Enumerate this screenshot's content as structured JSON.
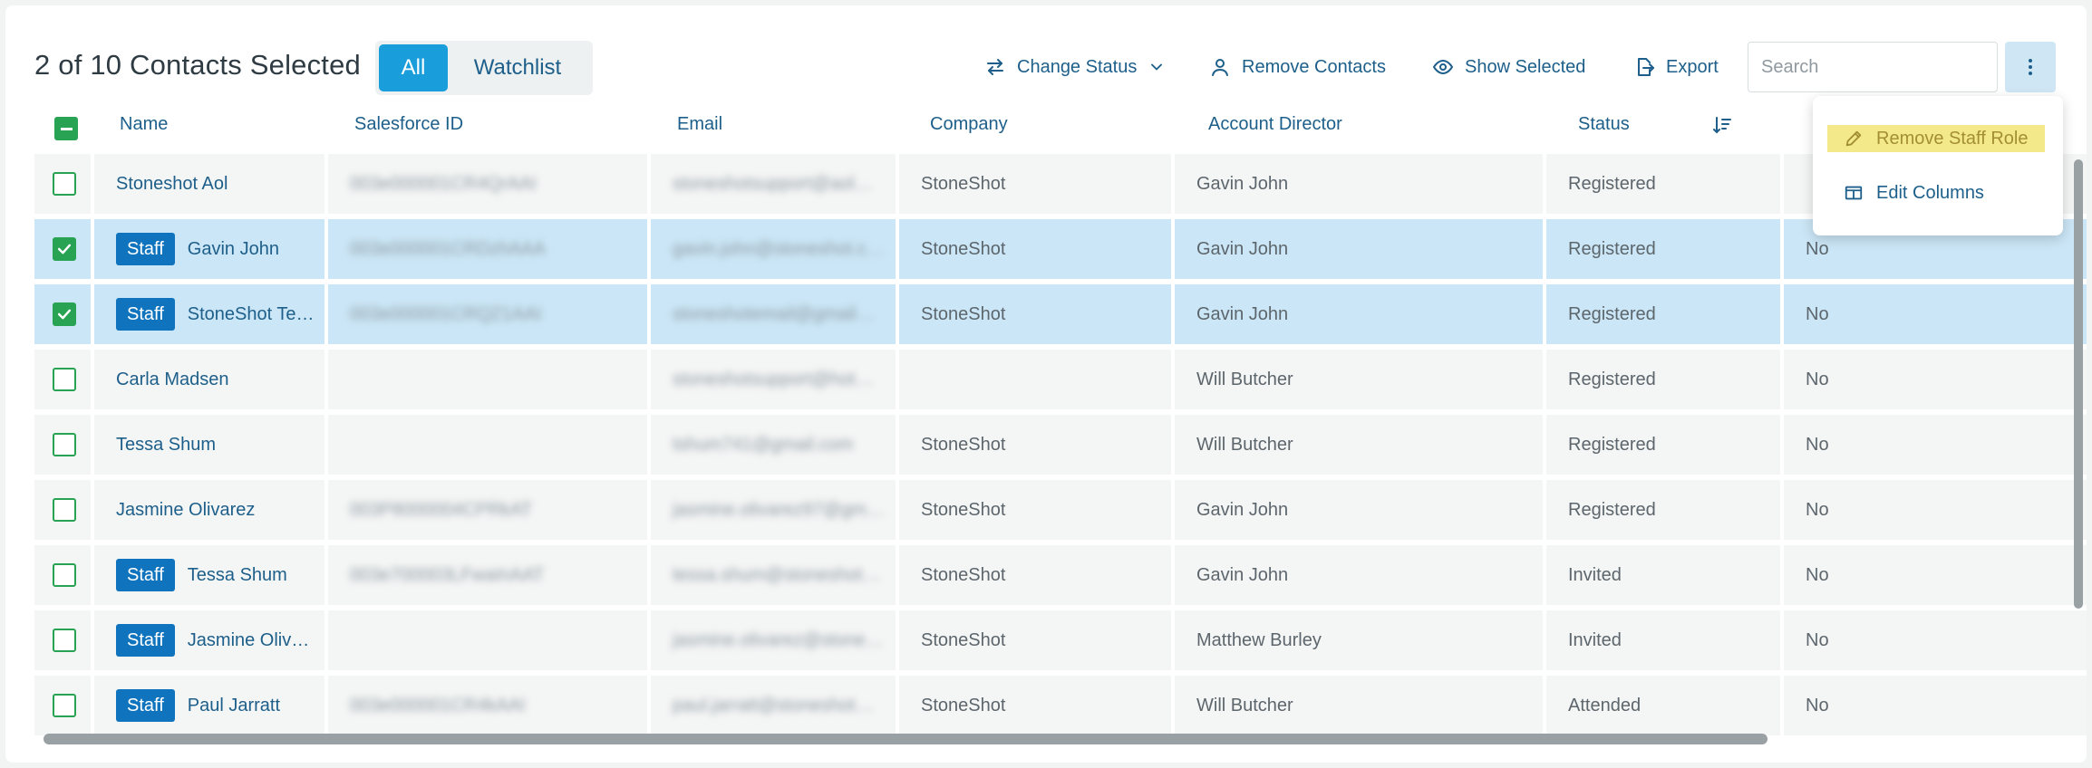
{
  "header": {
    "selected_count": "2 of 10 Contacts Selected",
    "filter_tabs": [
      {
        "label": "All",
        "active": true
      },
      {
        "label": "Watchlist",
        "active": false
      }
    ]
  },
  "toolbar": {
    "change_status": "Change Status",
    "remove_contacts": "Remove Contacts",
    "show_selected": "Show Selected",
    "export": "Export",
    "search_placeholder": "Search"
  },
  "table": {
    "columns": [
      "Name",
      "Salesforce ID",
      "Email",
      "Company",
      "Account Director",
      "Status"
    ],
    "staff_label": "Staff",
    "rows": [
      {
        "checked": false,
        "staff": false,
        "name": "Stoneshot Aol",
        "salesforce_id": "003e000001CR4QrAAI",
        "email": "stoneshotsupport@aol…",
        "company": "StoneShot",
        "director": "Gavin John",
        "status": "Registered",
        "extra": ""
      },
      {
        "checked": true,
        "staff": true,
        "name": "Gavin John",
        "salesforce_id": "003e000001CRDzhAAA",
        "email": "gavin.john@stoneshot.c…",
        "company": "StoneShot",
        "director": "Gavin John",
        "status": "Registered",
        "extra": "No"
      },
      {
        "checked": true,
        "staff": true,
        "name": "StoneShot Te…",
        "salesforce_id": "003e000001CRQZ1AAI",
        "email": "stoneshotemail@gmail…",
        "company": "StoneShot",
        "director": "Gavin John",
        "status": "Registered",
        "extra": "No"
      },
      {
        "checked": false,
        "staff": false,
        "name": "Carla Madsen",
        "salesforce_id": "",
        "email": "stoneshotsupport@hot…",
        "company": "",
        "director": "Will Butcher",
        "status": "Registered",
        "extra": "No"
      },
      {
        "checked": false,
        "staff": false,
        "name": "Tessa Shum",
        "salesforce_id": "",
        "email": "tshum741@gmail.com",
        "company": "StoneShot",
        "director": "Will Butcher",
        "status": "Registered",
        "extra": "No"
      },
      {
        "checked": false,
        "staff": false,
        "name": "Jasmine Olivarez",
        "salesforce_id": "003P8000004CPRkAT",
        "email": "jasmine.olivarez97@gm…",
        "company": "StoneShot",
        "director": "Gavin John",
        "status": "Registered",
        "extra": "No"
      },
      {
        "checked": false,
        "staff": true,
        "name": "Tessa Shum",
        "salesforce_id": "003e700003LFwaInAAT",
        "email": "tessa.shum@stoneshot…",
        "company": "StoneShot",
        "director": "Gavin John",
        "status": "Invited",
        "extra": "No"
      },
      {
        "checked": false,
        "staff": true,
        "name": "Jasmine Oliv…",
        "salesforce_id": "",
        "email": "jasmine.olivarez@stone…",
        "company": "StoneShot",
        "director": "Matthew Burley",
        "status": "Invited",
        "extra": "No"
      },
      {
        "checked": false,
        "staff": true,
        "name": "Paul Jarratt",
        "salesforce_id": "003e000001CR4kAAI",
        "email": "paul.jarratt@stoneshot…",
        "company": "StoneShot",
        "director": "Will Butcher",
        "status": "Attended",
        "extra": "No"
      }
    ]
  },
  "menu": {
    "items": [
      {
        "label": "Remove Staff Role",
        "icon": "pencil-icon"
      },
      {
        "label": "Edit Columns",
        "icon": "columns-icon"
      }
    ]
  },
  "colors": {
    "accent": "#1a9ddb",
    "link": "#1d5f8a",
    "checkbox": "#27a353",
    "staff_badge": "#0f74bd",
    "selected_row": "#cbe6f6",
    "highlight": "#f4e98a"
  }
}
